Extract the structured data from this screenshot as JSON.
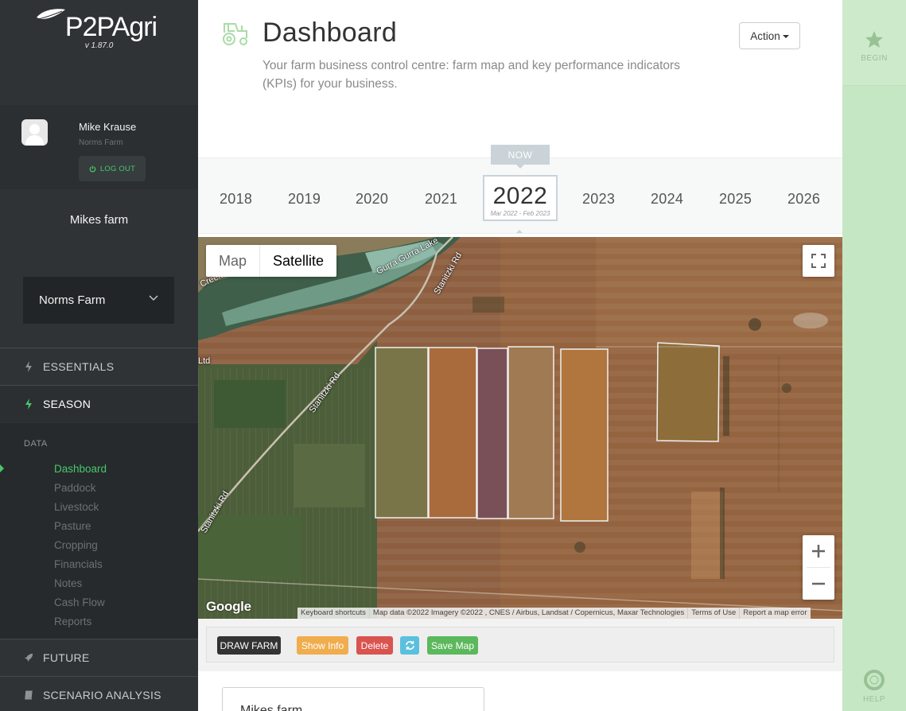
{
  "brand": {
    "name_part1": "P2P",
    "name_part2": "Agri",
    "version": "v 1.87.0"
  },
  "user": {
    "name": "Mike Krause",
    "farm": "Norms Farm",
    "logout_label": "LOG OUT"
  },
  "sidebar": {
    "farm_title": "Mikes farm",
    "farm_select_value": "Norms Farm",
    "sections": {
      "essentials": "ESSENTIALS",
      "season": "SEASON",
      "future": "FUTURE",
      "scenario": "SCENARIO ANALYSIS"
    },
    "data_label": "DATA",
    "items": [
      {
        "label": "Dashboard",
        "active": true
      },
      {
        "label": "Paddock",
        "active": false
      },
      {
        "label": "Livestock",
        "active": false
      },
      {
        "label": "Pasture",
        "active": false
      },
      {
        "label": "Cropping",
        "active": false
      },
      {
        "label": "Financials",
        "active": false
      },
      {
        "label": "Notes",
        "active": false
      },
      {
        "label": "Cash Flow",
        "active": false
      },
      {
        "label": "Reports",
        "active": false
      }
    ]
  },
  "header": {
    "title": "Dashboard",
    "description": "Your farm business control centre: farm map and key performance indicators (KPIs) for your business.",
    "action_label": "Action"
  },
  "years": {
    "now_label": "NOW",
    "list": [
      "2018",
      "2019",
      "2020",
      "2021",
      "2022",
      "2023",
      "2024",
      "2025",
      "2026"
    ],
    "selected": "2022",
    "selected_range": "Mar 2022 - Feb 2023"
  },
  "map": {
    "type_map": "Map",
    "type_satellite": "Satellite",
    "selected_type": "Satellite",
    "labels": {
      "lake": "Gurra Gurra Lake",
      "road1": "Stanitzki Rd",
      "road2": "Stanitzki Rd",
      "road3": "Stanitzki Rd",
      "creek": "Creek",
      "ltd": "Ltd"
    },
    "google": "Google",
    "attribution": {
      "shortcuts": "Keyboard shortcuts",
      "data": "Map data ©2022 Imagery ©2022 , CNES / Airbus, Landsat / Copernicus, Maxar Technologies",
      "terms": "Terms of Use",
      "report": "Report a map error"
    }
  },
  "toolbar": {
    "draw_farm": "DRAW FARM",
    "show_info": "Show Info",
    "delete": "Delete",
    "save_map": "Save Map"
  },
  "bottom_panel": {
    "title": "Mikes farm"
  },
  "right_rail": {
    "begin": "BEGIN",
    "help": "HELP"
  },
  "colors": {
    "sidebar_bg": "#2f3335",
    "accent_green": "#48c76a",
    "rail_bg": "#c6e7c4"
  },
  "icons": [
    "leaf-logo-icon",
    "power-icon",
    "chevron-down-icon",
    "bolt-icon",
    "rocket-icon",
    "book-icon",
    "tractor-icon",
    "star-icon",
    "lifebuoy-icon",
    "fullscreen-icon",
    "plus-icon",
    "minus-icon",
    "refresh-icon"
  ]
}
